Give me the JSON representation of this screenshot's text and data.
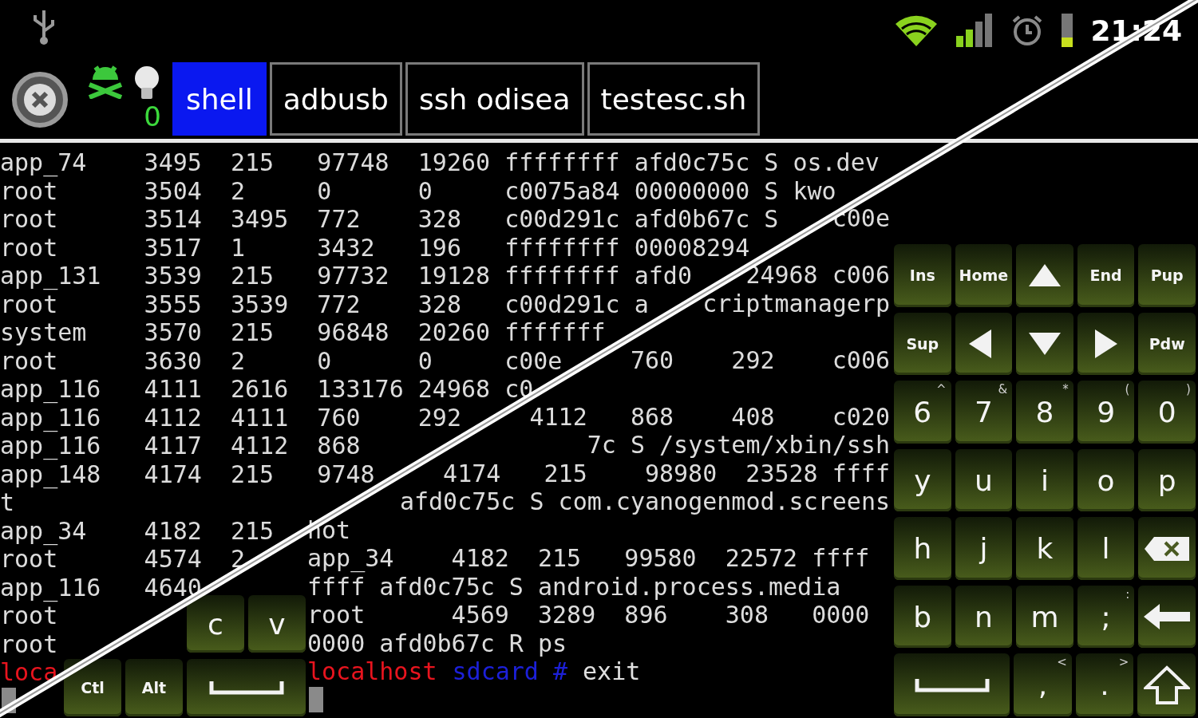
{
  "status_bar": {
    "time": "21:24"
  },
  "tab_bar": {
    "notification_count": "0",
    "tabs": [
      {
        "label": "shell",
        "selected": true
      },
      {
        "label": "adbusb",
        "selected": false
      },
      {
        "label": "ssh odisea",
        "selected": false
      },
      {
        "label": "testesc.sh",
        "selected": false
      }
    ]
  },
  "terminal_left": {
    "rows": [
      "app_74    3495  215   97748  19260 ffffffff afd0c75c S os.dev",
      "root      3504  2     0      0     c0075a84 00000000 S kwo",
      "root      3514  3495  772    328   c00d291c afd0b67c S",
      "root      3517  1     3432   196   ffffffff 00008294",
      "app_131   3539  215   97732  19128 ffffffff afd0",
      "root      3555  3539  772    328   c00d291c a",
      "system    3570  215   96848  20260 fffffff",
      "root      3630  2     0      0     c00e",
      "app_116   4111  2616  133176 24968 c0",
      "app_116   4112  4111  760    292",
      "app_116   4117  4112  868",
      "app_148   4174  215   9748",
      "t",
      "app_34    4182  215",
      "root      4574  2",
      "app_116   4640",
      "root",
      "root"
    ],
    "prompt": [
      {
        "text": "loca",
        "color": "#e8141e"
      }
    ]
  },
  "terminal_right": {
    "rows": [
      {
        "kind": "blank"
      },
      {
        "kind": "blank"
      },
      {
        "kind": "tail",
        "text": "c00e"
      },
      {
        "kind": "blank"
      },
      {
        "kind": "tail",
        "text": "24968 c006"
      },
      {
        "kind": "tail",
        "text": "criptmanagerp"
      },
      {
        "kind": "blank"
      },
      {
        "kind": "tail",
        "text": "760    292    c006"
      },
      {
        "kind": "blank"
      },
      {
        "kind": "tail",
        "text": "4112   868    408    c020"
      },
      {
        "kind": "tail",
        "text": "7c S /system/xbin/ssh"
      },
      {
        "kind": "tail",
        "text": "4174   215    98980  23528 ffff"
      },
      {
        "kind": "tail",
        "text": "afd0c75c S com.cyanogenmod.screens"
      },
      {
        "kind": "line",
        "text": "hot"
      },
      {
        "kind": "line",
        "text": "app_34    4182  215   99580  22572 ffff"
      },
      {
        "kind": "line",
        "text": "ffff afd0c75c S android.process.media"
      },
      {
        "kind": "line",
        "text": "root      4569  3289  896    308   0000"
      },
      {
        "kind": "line",
        "text": "0000 afd0b67c R ps"
      }
    ],
    "prompt": [
      {
        "text": "localhost",
        "color": "#e8141e"
      },
      {
        "text": "sdcard #",
        "color": "#1c20d8"
      },
      {
        "text": "exit",
        "color": "#e0e0e0"
      }
    ]
  },
  "keyboard_left": {
    "rows": [
      [
        {
          "kind": "char",
          "label": "c"
        },
        {
          "kind": "char",
          "label": "v"
        }
      ],
      [
        {
          "kind": "small",
          "label": "Ctl"
        },
        {
          "kind": "small",
          "label": "Alt"
        },
        {
          "kind": "space"
        }
      ]
    ]
  },
  "keyboard_right": {
    "rows": [
      [
        {
          "kind": "small",
          "label": "Ins"
        },
        {
          "kind": "small",
          "label": "Home"
        },
        {
          "kind": "up"
        },
        {
          "kind": "small",
          "label": "End"
        },
        {
          "kind": "small",
          "label": "Pup"
        }
      ],
      [
        {
          "kind": "small",
          "label": "Sup"
        },
        {
          "kind": "left"
        },
        {
          "kind": "down"
        },
        {
          "kind": "right"
        },
        {
          "kind": "small",
          "label": "Pdw"
        }
      ],
      [
        {
          "kind": "char",
          "label": "6",
          "alt": "^"
        },
        {
          "kind": "char",
          "label": "7",
          "alt": "&"
        },
        {
          "kind": "char",
          "label": "8",
          "alt": "*"
        },
        {
          "kind": "char",
          "label": "9",
          "alt": "("
        },
        {
          "kind": "char",
          "label": "0",
          "alt": ")"
        }
      ],
      [
        {
          "kind": "char",
          "label": "y"
        },
        {
          "kind": "char",
          "label": "u"
        },
        {
          "kind": "char",
          "label": "i"
        },
        {
          "kind": "char",
          "label": "o"
        },
        {
          "kind": "char",
          "label": "p"
        }
      ],
      [
        {
          "kind": "char",
          "label": "h"
        },
        {
          "kind": "char",
          "label": "j"
        },
        {
          "kind": "char",
          "label": "k"
        },
        {
          "kind": "char",
          "label": "l"
        },
        {
          "kind": "backspace"
        }
      ],
      [
        {
          "kind": "char",
          "label": "b"
        },
        {
          "kind": "char",
          "label": "n"
        },
        {
          "kind": "char",
          "label": "m"
        },
        {
          "kind": "char",
          "label": ";",
          "alt": ":"
        },
        {
          "kind": "enter"
        }
      ]
    ],
    "bottom_row": [
      {
        "kind": "space"
      },
      {
        "kind": "char",
        "label": ",",
        "alt": "<"
      },
      {
        "kind": "char",
        "label": ".",
        "alt": ">"
      },
      {
        "kind": "shift"
      }
    ]
  }
}
